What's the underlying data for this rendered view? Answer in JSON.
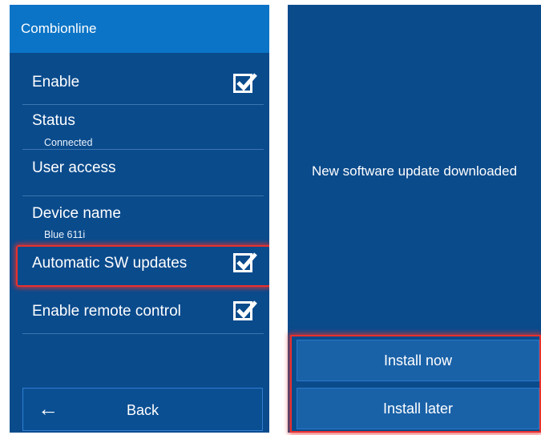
{
  "settings": {
    "header": {
      "title": "Combionline"
    },
    "enable": {
      "label": "Enable",
      "checked": true
    },
    "status": {
      "label": "Status",
      "value": "Connected"
    },
    "user_access": {
      "label": "User access"
    },
    "device_name": {
      "label": "Device name",
      "value": "Blue 611i"
    },
    "auto_sw_updates": {
      "label": "Automatic SW updates",
      "checked": true
    },
    "remote_control": {
      "label": "Enable remote control",
      "checked": true
    },
    "back": {
      "arrow": "←",
      "label": "Back"
    }
  },
  "dialog": {
    "message": "New software update downloaded",
    "install_now": "Install now",
    "install_later": "Install later"
  },
  "colors": {
    "panel": "#0a4b8c",
    "header": "#0b74c6",
    "highlight": "#e8312e"
  }
}
